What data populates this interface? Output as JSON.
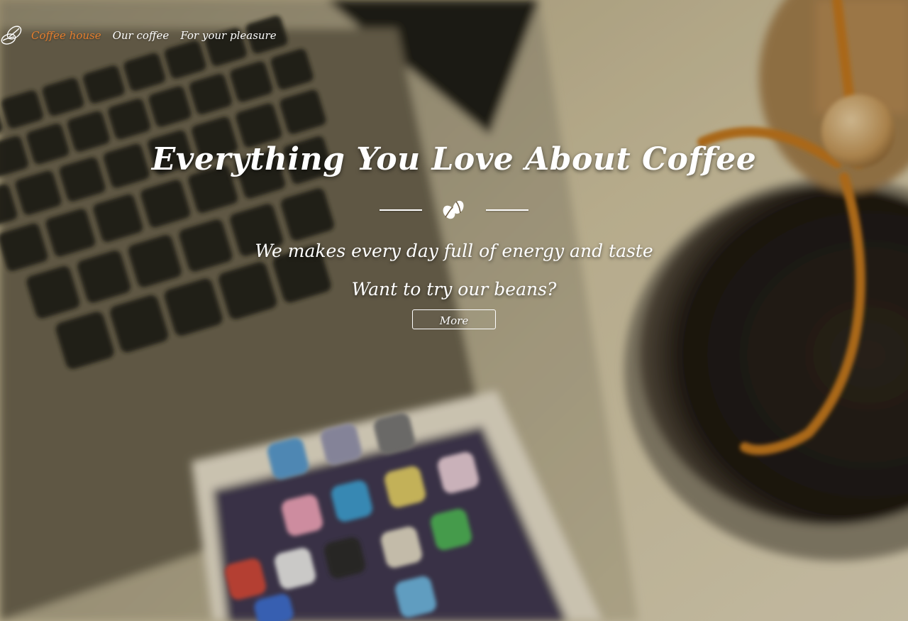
{
  "nav": {
    "logo_icon": "coffee-beans-icon",
    "items": [
      {
        "label": "Coffee house",
        "active": true
      },
      {
        "label": "Our coffee",
        "active": false
      },
      {
        "label": "For your pleasure",
        "active": false
      }
    ]
  },
  "hero": {
    "title": "Everything You Love About Coffee",
    "divider_icon": "coffee-beans-icon",
    "subtitle": "We makes every day full of energy and taste",
    "question": "Want to try our beans?",
    "button_label": "More"
  },
  "colors": {
    "accent": "#e57e2e",
    "text": "#ffffff"
  }
}
